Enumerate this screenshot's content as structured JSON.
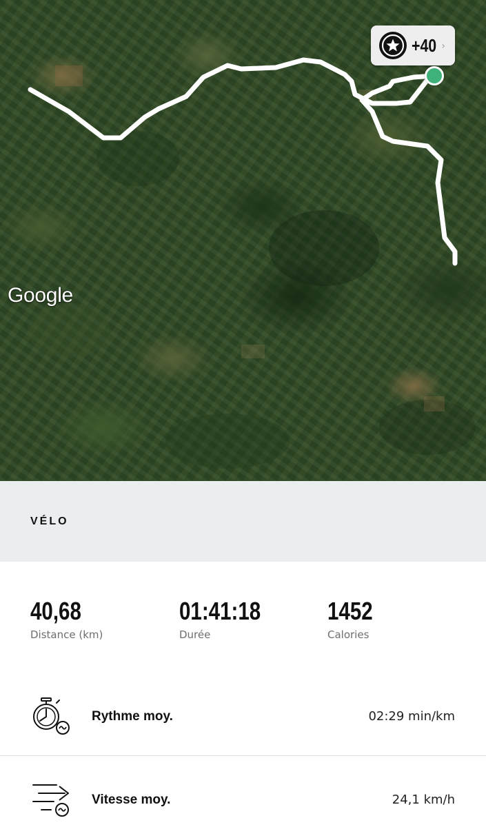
{
  "map": {
    "provider_logo": "Google",
    "badge": {
      "icon": "star-icon",
      "count": "+40",
      "chevron": "chevron-right-icon"
    },
    "start_marker_color": "#3fb17a",
    "route_color": "#ffffff"
  },
  "activity": {
    "type": "VÉLO"
  },
  "stats": [
    {
      "value": "40,68",
      "label": "Distance (km)"
    },
    {
      "value": "01:41:18",
      "label": "Durée"
    },
    {
      "value": "1452",
      "label": "Calories"
    }
  ],
  "metrics": [
    {
      "icon": "stopwatch-icon",
      "label": "Rythme moy.",
      "value": "02:29 min/km"
    },
    {
      "icon": "speed-icon",
      "label": "Vitesse moy.",
      "value": "24,1 km/h"
    }
  ]
}
